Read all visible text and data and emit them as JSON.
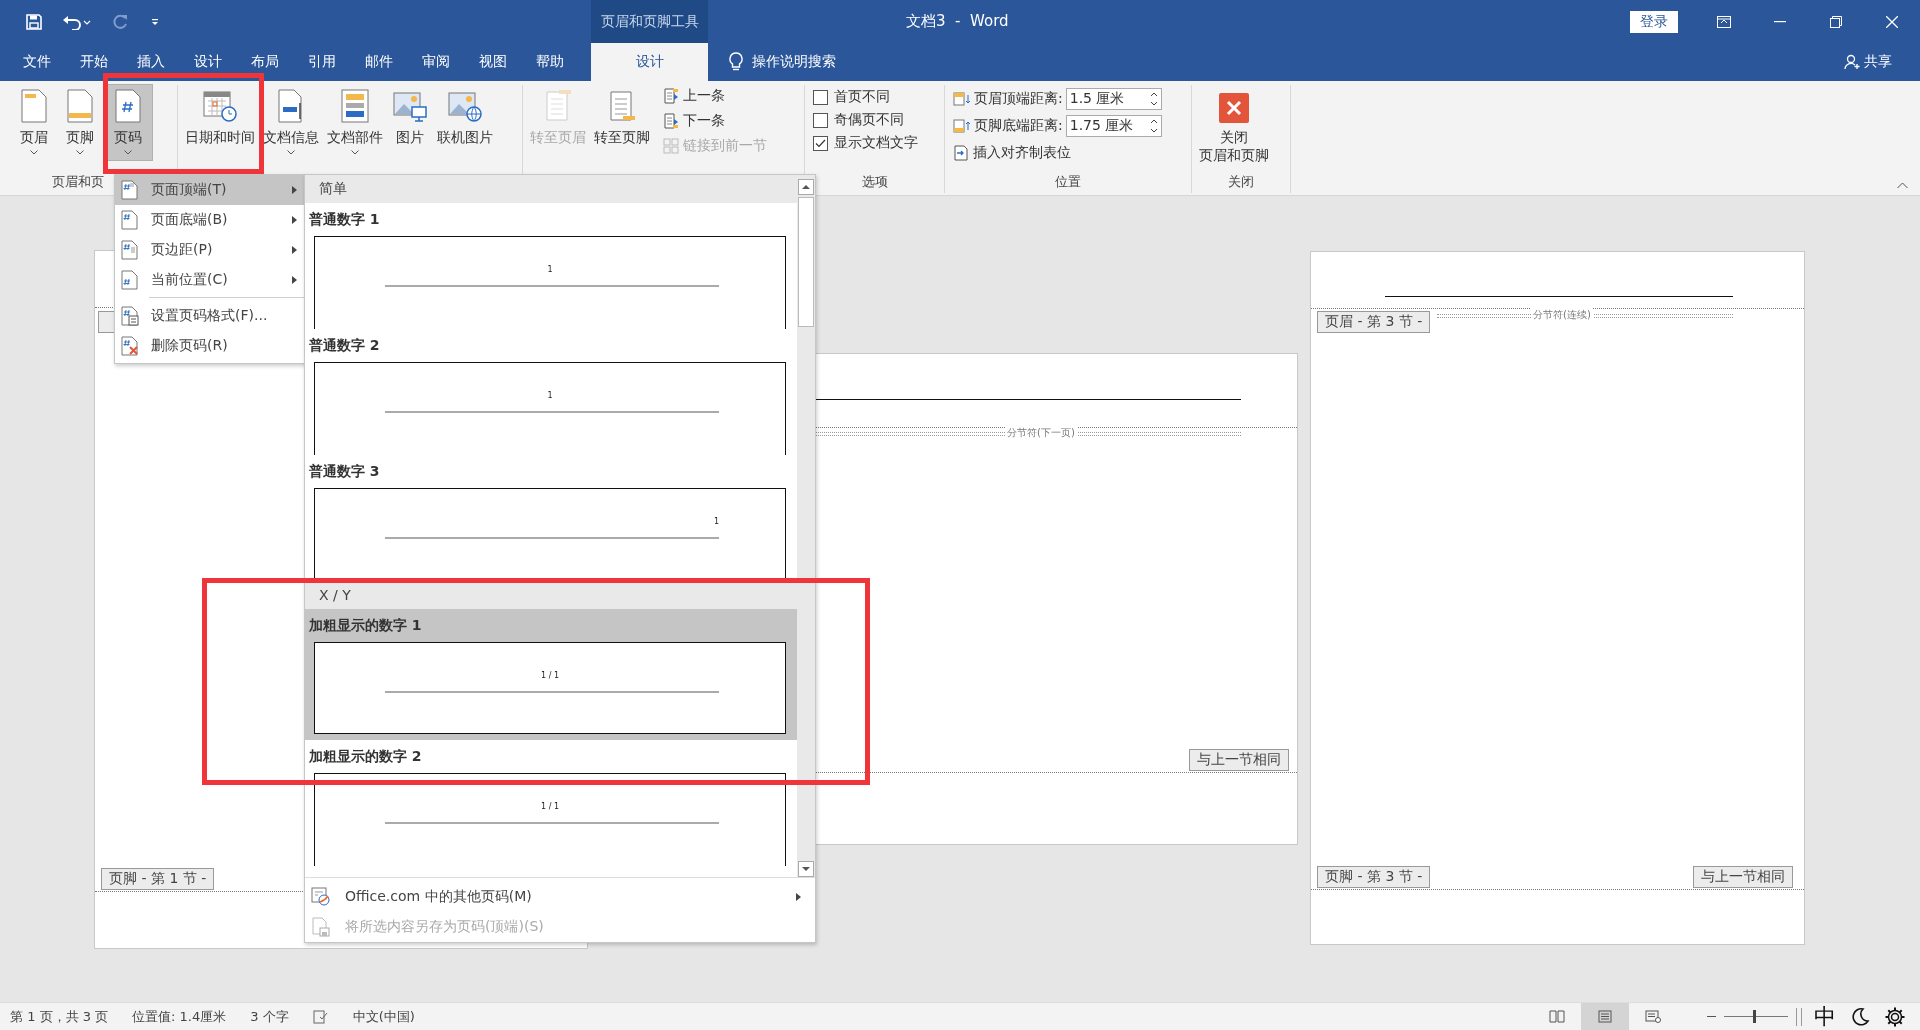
{
  "title_bar": {
    "quick_access": [
      {
        "kind": "save",
        "disabled": false
      },
      {
        "kind": "undo",
        "disabled": false
      },
      {
        "kind": "redo",
        "disabled": true
      },
      {
        "kind": "customize",
        "disabled": false
      }
    ],
    "context_label": "页眉和页脚工具",
    "title": "文档3  -  Word",
    "sign_in": "登录"
  },
  "tabs": [
    {
      "label": "文件",
      "selected": false,
      "contextual": false
    },
    {
      "label": "开始",
      "selected": false,
      "contextual": false
    },
    {
      "label": "插入",
      "selected": false,
      "contextual": false
    },
    {
      "label": "设计",
      "selected": false,
      "contextual": false
    },
    {
      "label": "布局",
      "selected": false,
      "contextual": false
    },
    {
      "label": "引用",
      "selected": false,
      "contextual": false
    },
    {
      "label": "邮件",
      "selected": false,
      "contextual": false
    },
    {
      "label": "审阅",
      "selected": false,
      "contextual": false
    },
    {
      "label": "视图",
      "selected": false,
      "contextual": false
    },
    {
      "label": "帮助",
      "selected": false,
      "contextual": false
    },
    {
      "label": "设计",
      "selected": true,
      "contextual": true
    }
  ],
  "tell_me": "操作说明搜索",
  "share": "共享",
  "ribbon": {
    "header_footer": {
      "label": "页眉和页",
      "buttons": [
        {
          "kind": "header",
          "label": "页眉",
          "dropdown": true,
          "pressed": false
        },
        {
          "kind": "footer",
          "label": "页脚",
          "dropdown": true,
          "pressed": false
        },
        {
          "kind": "page_number",
          "label": "页码",
          "dropdown": true,
          "pressed": true
        }
      ]
    },
    "insert": {
      "buttons": [
        {
          "kind": "datetime",
          "label": "日期和时间",
          "dropdown": false
        },
        {
          "kind": "doc_info",
          "label": "文档信息",
          "dropdown": true
        },
        {
          "kind": "quick_parts",
          "label": "文档部件",
          "dropdown": true
        },
        {
          "kind": "picture",
          "label": "图片",
          "dropdown": false
        },
        {
          "kind": "online_picture",
          "label": "联机图片",
          "dropdown": false
        }
      ]
    },
    "navigation": {
      "large": [
        {
          "label": "转至页眉",
          "disabled": true
        },
        {
          "label": "转至页脚",
          "disabled": false
        }
      ],
      "small": [
        {
          "kind": "prev",
          "label": "上一条",
          "disabled": false
        },
        {
          "kind": "next",
          "label": "下一条",
          "disabled": false
        },
        {
          "kind": "link",
          "label": "链接到前一节",
          "disabled": true
        }
      ]
    },
    "options": {
      "label": "选项",
      "checkboxes": [
        {
          "label": "首页不同",
          "checked": false
        },
        {
          "label": "奇偶页不同",
          "checked": false
        },
        {
          "label": "显示文档文字",
          "checked": true
        }
      ]
    },
    "position": {
      "label": "位置",
      "fields": [
        {
          "kind": "top",
          "label": "页眉顶端距离:",
          "value": "1.5 厘米"
        },
        {
          "kind": "bottom",
          "label": "页脚底端距离:",
          "value": "1.75 厘米"
        }
      ],
      "tab_button": "插入对齐制表位"
    },
    "close": {
      "label": "关闭",
      "button": [
        "关闭",
        "页眉和页脚"
      ]
    }
  },
  "page_number_menu": {
    "items": [
      {
        "kind": "top",
        "label": "页面顶端(T)",
        "submenu": true,
        "selected": true,
        "separator_before": false
      },
      {
        "kind": "bottom",
        "label": "页面底端(B)",
        "submenu": true,
        "selected": false,
        "separator_before": false
      },
      {
        "kind": "margin",
        "label": "页边距(P)",
        "submenu": true,
        "selected": false,
        "separator_before": false
      },
      {
        "kind": "current",
        "label": "当前位置(C)",
        "submenu": true,
        "selected": false,
        "separator_before": false
      },
      {
        "kind": "format",
        "label": "设置页码格式(F)...",
        "submenu": false,
        "selected": false,
        "separator_before": true
      },
      {
        "kind": "remove",
        "label": "删除页码(R)",
        "submenu": false,
        "selected": false,
        "separator_before": false
      }
    ]
  },
  "gallery": {
    "sections": [
      {
        "title": "简单",
        "items": [
          {
            "label": "普通数字 1",
            "preview": "1",
            "align_right": false,
            "selected": false
          },
          {
            "label": "普通数字 2",
            "preview": "1",
            "align_right": false,
            "selected": false
          },
          {
            "label": "普通数字 3",
            "preview": "1",
            "align_right": true,
            "selected": false
          }
        ]
      },
      {
        "title": "X / Y",
        "items": [
          {
            "label": "加粗显示的数字 1",
            "preview": "1 / 1",
            "align_right": false,
            "selected": true
          },
          {
            "label": "加粗显示的数字 2",
            "preview": "1 / 1",
            "align_right": false,
            "selected": false
          }
        ]
      }
    ],
    "footer": [
      {
        "kind": "online",
        "label": "Office.com 中的其他页码(M)",
        "submenu": true,
        "disabled": false
      },
      {
        "kind": "save",
        "label": "将所选内容另存为页码(顶端)(S)",
        "submenu": false,
        "disabled": true
      }
    ]
  },
  "document": {
    "page_1": {
      "footer_tag": "页脚 - 第 1 节 -"
    },
    "page_2": {
      "break_label": "分节符(下一页)",
      "same_as_previous": "与上一节相同"
    },
    "page_3": {
      "header_tag": "页眉 - 第 3 节 -",
      "break_label": "分节符(连续)",
      "footer_tag": "页脚 - 第 3 节 -",
      "same_as_previous": "与上一节相同"
    }
  },
  "status_bar": {
    "items": [
      "第 1 页，共 3 页",
      "位置值: 1.4厘米",
      "3 个字"
    ],
    "language": "中文(中国)",
    "views": [
      {
        "kind": "read",
        "selected": false
      },
      {
        "kind": "print",
        "selected": true
      },
      {
        "kind": "web",
        "selected": false
      }
    ],
    "zoom": {
      "level": 0.45
    },
    "ime": "中"
  }
}
